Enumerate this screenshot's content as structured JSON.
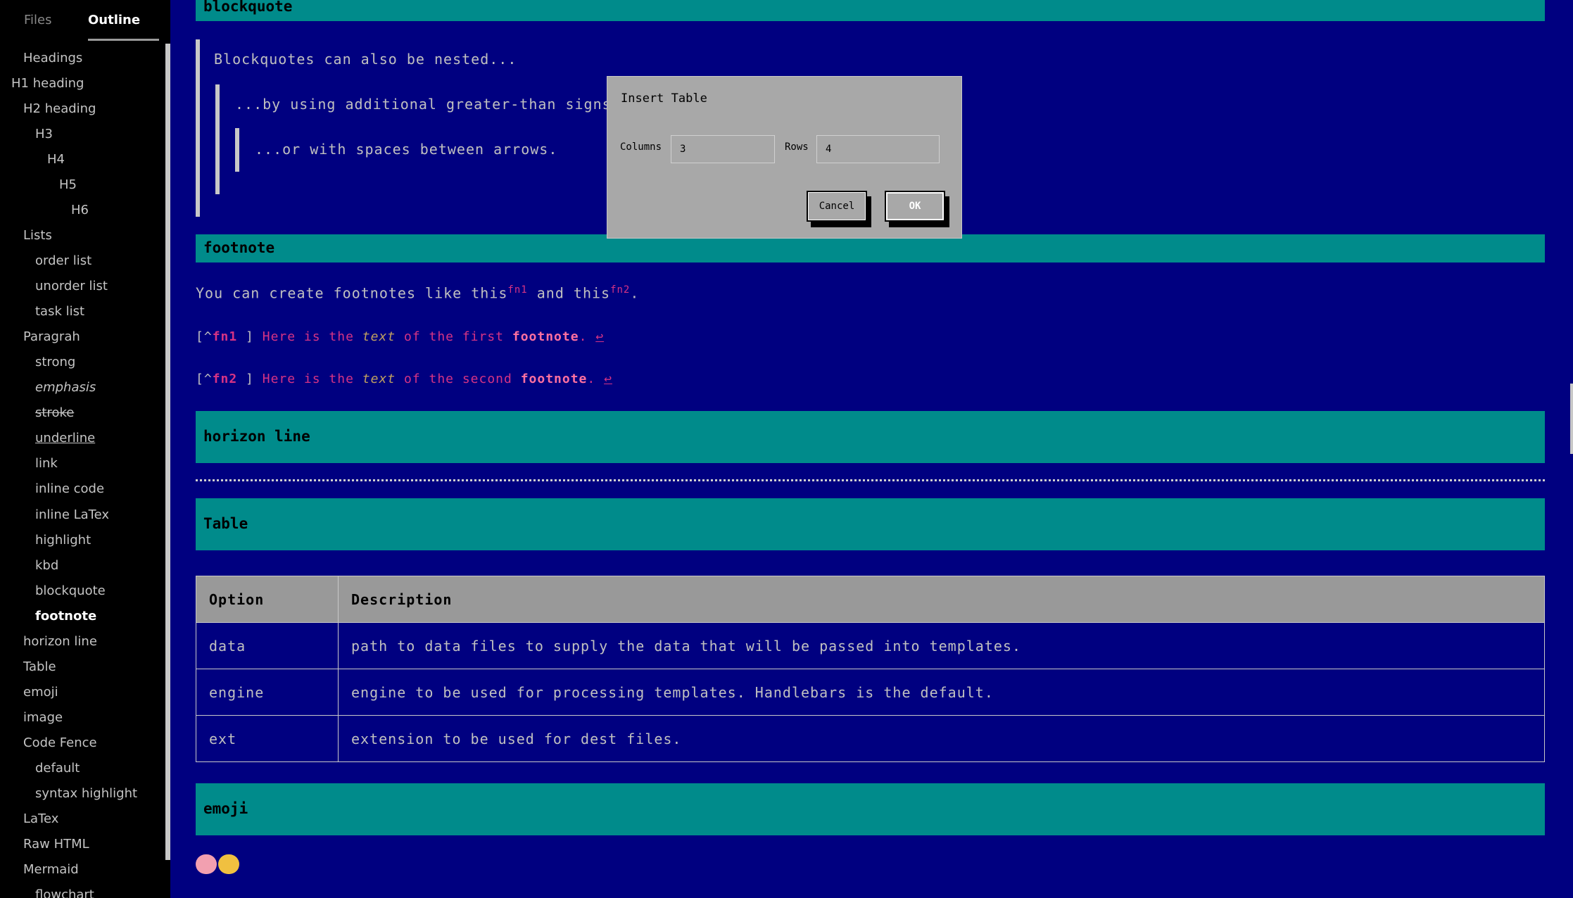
{
  "sidebar": {
    "tabs": {
      "files": "Files",
      "outline": "Outline"
    },
    "items": [
      {
        "label": "Headings"
      },
      {
        "label": "H1 heading"
      },
      {
        "label": "H2 heading"
      },
      {
        "label": "H3"
      },
      {
        "label": "H4"
      },
      {
        "label": "H5"
      },
      {
        "label": "H6"
      },
      {
        "label": "Lists"
      },
      {
        "label": "order list"
      },
      {
        "label": "unorder list"
      },
      {
        "label": "task list"
      },
      {
        "label": "Paragrah"
      },
      {
        "label": "strong"
      },
      {
        "label": "emphasis"
      },
      {
        "label": "stroke"
      },
      {
        "label": "underline"
      },
      {
        "label": "link"
      },
      {
        "label": "inline code"
      },
      {
        "label": "inline LaTex"
      },
      {
        "label": "highlight"
      },
      {
        "label": "kbd"
      },
      {
        "label": "blockquote"
      },
      {
        "label": "footnote"
      },
      {
        "label": "horizon line"
      },
      {
        "label": "Table"
      },
      {
        "label": "emoji"
      },
      {
        "label": "image"
      },
      {
        "label": "Code Fence"
      },
      {
        "label": "default"
      },
      {
        "label": "syntax highlight"
      },
      {
        "label": "LaTex"
      },
      {
        "label": "Raw HTML"
      },
      {
        "label": "Mermaid"
      },
      {
        "label": "flowchart"
      }
    ]
  },
  "content": {
    "blockquote_heading": "blockquote",
    "bq1": "Blockquotes can also be nested...",
    "bq2": "...by using additional greater-than signs right next to each other...",
    "bq3": "...or with spaces between arrows.",
    "footnote_heading": "footnote",
    "fn_para_a": "You can create footnotes like this",
    "fn_ref1": "fn1",
    "fn_para_b": " and this",
    "fn_ref2": "fn2",
    "fn_para_c": ".",
    "fn1": {
      "open": "[^",
      "label": "fn1",
      "close": " ]",
      "p1": " Here is the ",
      "italic": "text",
      "p2": " of the first ",
      "bold": "footnote",
      "p3": ". ",
      "back": "↩"
    },
    "fn2": {
      "open": "[^",
      "label": "fn2",
      "close": " ]",
      "p1": " Here is the ",
      "italic": "text",
      "p2": " of the second ",
      "bold": "footnote",
      "p3": ". ",
      "back": "↩"
    },
    "horizon_heading": "horizon line",
    "table_heading": "Table",
    "table": {
      "headers": [
        "Option",
        "Description"
      ],
      "rows": [
        [
          "data",
          "path to data files to supply the data that will be passed into templates."
        ],
        [
          "engine",
          "engine to be used for processing templates. Handlebars is the default."
        ],
        [
          "ext",
          "extension to be used for dest files."
        ]
      ]
    },
    "emoji_heading": "emoji",
    "emojis": [
      "pig-face-emoji",
      "cat-face-emoji"
    ]
  },
  "dialog": {
    "title": "Insert Table",
    "columns_label": "Columns",
    "columns_value": "3",
    "rows_label": "Rows",
    "rows_value": "4",
    "cancel_label": "Cancel",
    "ok_label": "OK"
  },
  "colors": {
    "background": "#000080",
    "heading_bar": "#008b8b",
    "footnote_accent": "#d63384",
    "sidebar_bg": "#000000",
    "dialog_bg": "#a8a8a8"
  }
}
